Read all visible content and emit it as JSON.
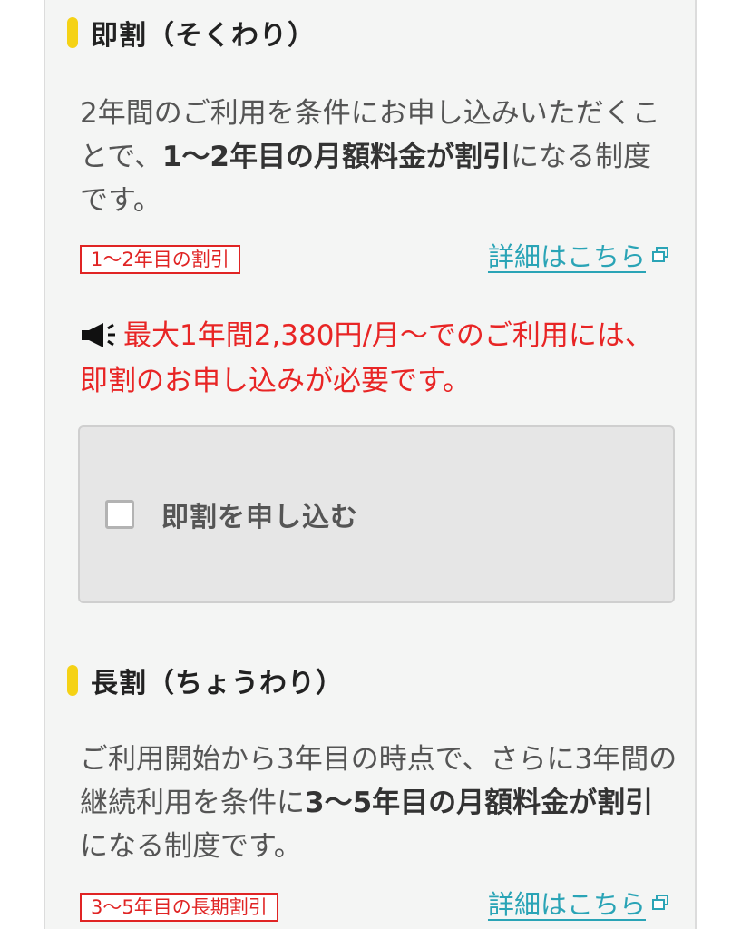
{
  "sokuwari": {
    "title": "即割（そくわり）",
    "desc_1": "2年間のご利用を条件にお申し込みいただくことで、",
    "desc_bold": "1〜2年目の月額料金が割引",
    "desc_2": "になる制度です。",
    "tag": "1〜2年目の割引",
    "detail_link": "詳細はこちら",
    "notice": "最大1年間2,380円/月〜でのご利用には、即割のお申し込みが必要です。",
    "checkbox_label": "即割を申し込む",
    "checked": false
  },
  "chouwari": {
    "title": "長割（ちょうわり）",
    "desc_1": "ご利用開始から3年目の時点で、さらに3年間の継続利用を条件に",
    "desc_bold": "3〜5年目の月額料金が割引",
    "desc_2": "になる制度です。",
    "tag": "3〜5年目の長期割引",
    "detail_link": "詳細はこちら"
  },
  "colors": {
    "accent_yellow": "#f5d215",
    "alert_red": "#e82525",
    "link_teal": "#2aa4b6"
  },
  "icons": {
    "notice": "megaphone-icon",
    "link": "external-link-icon"
  }
}
